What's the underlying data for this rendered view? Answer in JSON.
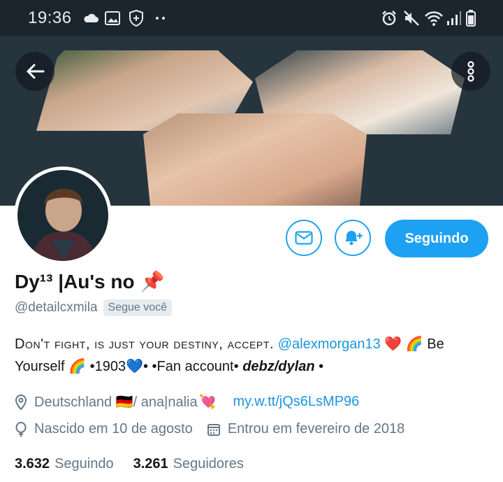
{
  "status_bar": {
    "time": "19:36",
    "left_icons": [
      "cloud-icon",
      "image-icon",
      "shield-icon",
      "more-dots-icon"
    ],
    "right_icons": [
      "alarm-icon",
      "mute-icon",
      "wifi-icon",
      "signal-icon",
      "battery-icon"
    ]
  },
  "header": {
    "back_icon": "arrow-left-icon",
    "menu_icon": "overflow-menu-icon"
  },
  "profile": {
    "display_name": "Dy¹³ |Au's no",
    "name_emoji": "📌",
    "handle": "@detailcxmila",
    "follows_you_badge": "Segue você",
    "bio": {
      "caps_text": "Don't fight, is just your destiny, accept.",
      "mention": "@alexmorgan13",
      "emoji_heart": "❤️",
      "emoji_rainbow": "🌈",
      "text1": "Be Yourself",
      "text2": "•1903",
      "emoji_blue_heart": "💙",
      "text3": "• •Fan account•",
      "bold_italic": "debz/dylan",
      "text4": "•"
    },
    "location": "Deutschland 🇩🇪/ ana|nalia",
    "location_emoji": "💘",
    "website": "my.w.tt/jQs6LsMP96",
    "birthday": "Nascido em 10 de agosto",
    "joined": "Entrou em fevereiro de 2018",
    "following_count": "3.632",
    "following_label": "Seguindo",
    "followers_count": "3.261",
    "followers_label": "Seguidores"
  },
  "actions": {
    "message_icon": "mail-icon",
    "notify_icon": "bell-plus-icon",
    "follow_button_label": "Seguindo"
  },
  "colors": {
    "accent": "#1da1f2",
    "link": "#1b95e0",
    "status_bar_bg": "#1b252e",
    "banner_bg": "#26343e",
    "muted_text": "#657786"
  }
}
